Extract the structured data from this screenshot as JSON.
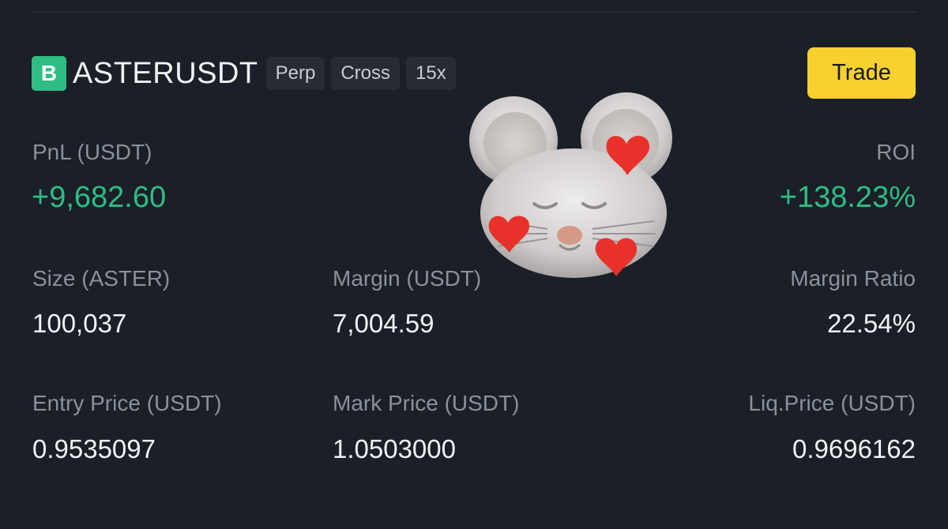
{
  "position": {
    "side_letter": "B",
    "symbol": "ASTERUSDT",
    "tags": [
      "Perp",
      "Cross",
      "15x"
    ],
    "trade_button": "Trade",
    "pnl": {
      "label": "PnL (USDT)",
      "value": "+9,682.60"
    },
    "roi": {
      "label": "ROI",
      "value": "+138.23%"
    },
    "size": {
      "label": "Size (ASTER)",
      "value": "100,037"
    },
    "margin": {
      "label": "Margin (USDT)",
      "value": "7,004.59"
    },
    "margin_ratio": {
      "label": "Margin Ratio",
      "value": "22.54%"
    },
    "entry_price": {
      "label": "Entry Price (USDT)",
      "value": "0.9535097"
    },
    "mark_price": {
      "label": "Mark Price (USDT)",
      "value": "1.0503000"
    },
    "liq_price": {
      "label": "Liq.Price (USDT)",
      "value": "0.9696162"
    }
  },
  "overlay": {
    "icon": "mouse-with-hearts-emoji-icon"
  },
  "colors": {
    "background": "#1b1f27",
    "profit_green": "#2ebd85",
    "trade_yellow": "#f8d12f",
    "tag_bg": "#262b34",
    "label_gray": "#8a919e"
  }
}
